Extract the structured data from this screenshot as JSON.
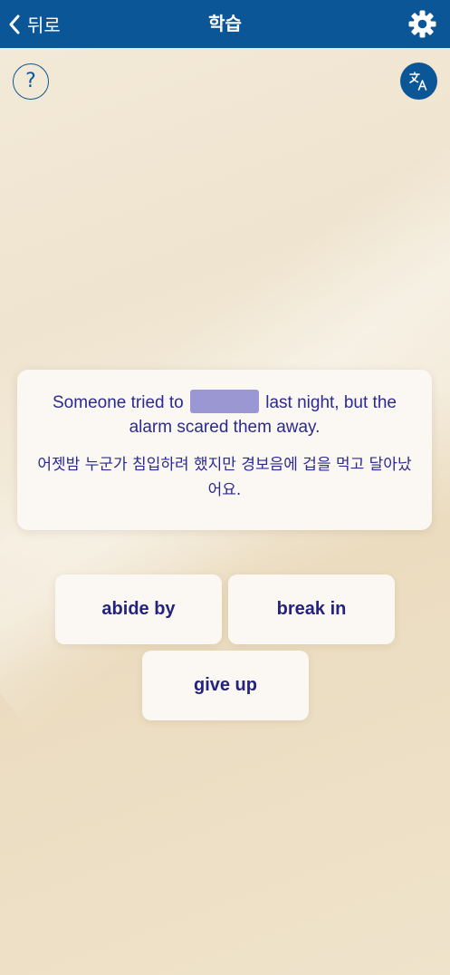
{
  "nav": {
    "back_label": "뒤로",
    "title": "학습",
    "color": "#0b5697"
  },
  "icons": {
    "back": "chevron-left-icon",
    "settings": "gear-icon",
    "help": "question-icon",
    "translate": "translate-icon"
  },
  "help": {
    "label": "?"
  },
  "card": {
    "sentence_before": "Someone tried to",
    "sentence_after": "last night, but the alarm scared them away.",
    "translation": "어젯밤 누군가 침입하려 했지만 경보음에 겁을 먹고 달아났어요."
  },
  "options": [
    {
      "label": "abide by"
    },
    {
      "label": "break in"
    },
    {
      "label": "give up"
    }
  ],
  "colors": {
    "text": "#2a2a8f",
    "blank": "#9b97d3"
  }
}
